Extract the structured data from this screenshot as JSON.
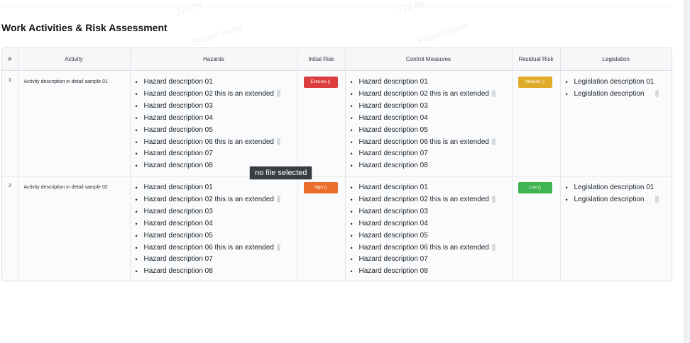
{
  "heading": "Work Activities & Risk Assessment",
  "watermarks": [
    "123 Sa",
    "123 Sa",
    "Project Name",
    "Project Name"
  ],
  "columns": [
    "#",
    "Activity",
    "Hazards",
    "Initial Risk",
    "Control Measures",
    "Residual Risk",
    "Legislation"
  ],
  "rows": [
    {
      "index": "1",
      "activity": "Activity description in detail sample 01",
      "hazards": [
        "Hazard description 01",
        "Hazard description 02 this is an extended",
        "Hazard description 03",
        "Hazard description 04",
        "Hazard description 05",
        "Hazard description 06 this is an extended",
        "Hazard description 07",
        "Hazard description 08"
      ],
      "initial_risk": {
        "label": "Extreme ()",
        "color": "#dc3d3d"
      },
      "controls": [
        "Hazard description 01",
        "Hazard description 02 this is an extended",
        "Hazard description 03",
        "Hazard description 04",
        "Hazard description 05",
        "Hazard description 06 this is an extended",
        "Hazard description 07",
        "Hazard description 08"
      ],
      "residual_risk": {
        "label": "Medium ()",
        "color": "#e0ab28"
      },
      "legislation": [
        "Legislation description 01",
        "Legislation description"
      ]
    },
    {
      "index": "2",
      "activity": "Activity description in detail sample 02",
      "hazards": [
        "Hazard description 01",
        "Hazard description 02 this is an extended",
        "Hazard description 03",
        "Hazard description 04",
        "Hazard description 05",
        "Hazard description 06 this is an extended",
        "Hazard description 07",
        "Hazard description 08"
      ],
      "initial_risk": {
        "label": "High ()",
        "color": "#ea6d2c"
      },
      "controls": [
        "Hazard description 01",
        "Hazard description 02 this is an extended",
        "Hazard description 03",
        "Hazard description 04",
        "Hazard description 05",
        "Hazard description 06 this is an extended",
        "Hazard description 07",
        "Hazard description 08"
      ],
      "residual_risk": {
        "label": "Low ()",
        "color": "#3fb450"
      },
      "legislation": [
        "Legislation description 01",
        "Legislation description"
      ]
    }
  ],
  "extended_marker_indices": [
    1,
    5
  ],
  "tooltip": "no file selected"
}
